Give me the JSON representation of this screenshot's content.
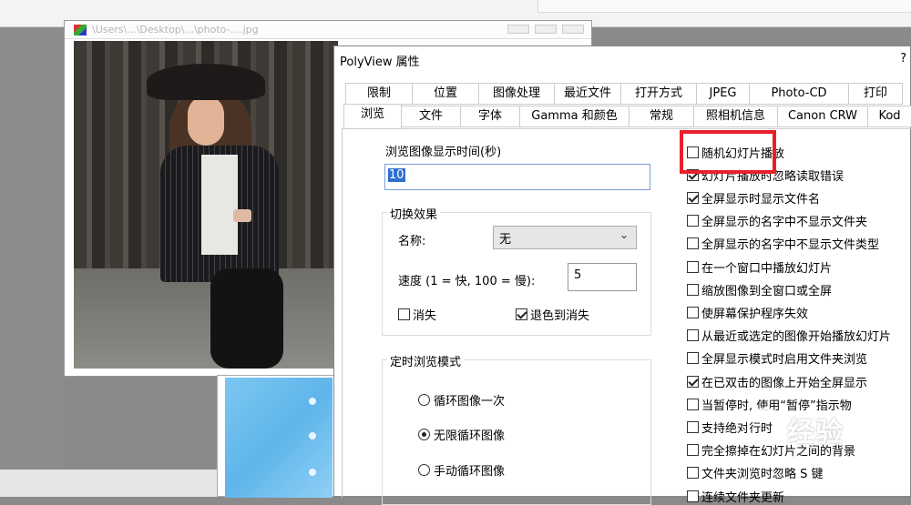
{
  "image_window": {
    "title": "\\Users\\...\\Desktop\\...\\photo-....jpg"
  },
  "dialog": {
    "title": "PolyView 属性",
    "help": "?",
    "tabs_row1": [
      "限制",
      "位置",
      "图像处理",
      "最近文件",
      "打开方式",
      "JPEG",
      "Photo-CD",
      "打印"
    ],
    "tabs_row2": [
      "浏览",
      "文件",
      "字体",
      "Gamma 和颜色",
      "常规",
      "照相机信息",
      "Canon CRW",
      "Kod"
    ],
    "active_tab": "浏览"
  },
  "browse": {
    "display_time_label": "浏览图像显示时间(秒)",
    "display_time_value": "10",
    "transition_group": "切换效果",
    "name_label": "名称:",
    "name_value": "无",
    "speed_label": "速度 (1 = 快, 100 = 慢):",
    "speed_value": "5",
    "fade_label": "消失",
    "fade_to_bg_label": "退色到消失",
    "timed_group": "定时浏览模式",
    "radio_loop_once": "循环图像一次",
    "radio_infinite": "无限循环图像",
    "radio_manual": "手动循环图像"
  },
  "options": [
    {
      "label": "随机幻灯片播放",
      "checked": false
    },
    {
      "label": "幻灯片播放时忽略读取错误",
      "checked": true
    },
    {
      "label": "全屏显示时显示文件名",
      "checked": true
    },
    {
      "label": "全屏显示的名字中不显示文件夹",
      "checked": false
    },
    {
      "label": "全屏显示的名字中不显示文件类型",
      "checked": false
    },
    {
      "label": "在一个窗口中播放幻灯片",
      "checked": false
    },
    {
      "label": "缩放图像到全窗口或全屏",
      "checked": false
    },
    {
      "label": "使屏幕保护程序失效",
      "checked": false
    },
    {
      "label": "从最近或选定的图像开始播放幻灯片",
      "checked": false
    },
    {
      "label": "全屏显示模式时启用文件夹浏览",
      "checked": false
    },
    {
      "label": "在已双击的图像上开始全屏显示",
      "checked": true
    },
    {
      "label": "当暂停时, 使用“暂停”指示物",
      "checked": false
    },
    {
      "label": "支持绝对行时",
      "checked": false
    },
    {
      "label": "完全擦掉在幻灯片之间的背景",
      "checked": false
    },
    {
      "label": "文件夹浏览时忽略 S 键",
      "checked": false
    },
    {
      "label": "连续文件夹更新",
      "checked": false
    }
  ],
  "watermark": {
    "text": "经验"
  },
  "colors": {
    "highlight": "#e8202a",
    "selection": "#2f6fd1"
  }
}
